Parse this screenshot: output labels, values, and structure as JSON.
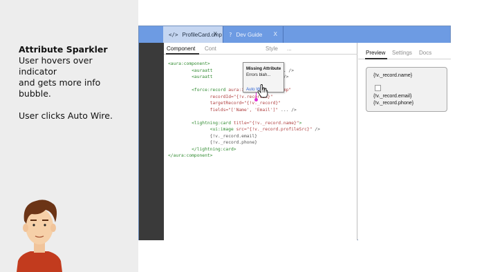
{
  "caption": {
    "title": "Attribute Sparkler",
    "body": "User hovers over indicator\nand gets more info\nbubble.",
    "action": "User clicks Auto Wire."
  },
  "tabs": [
    {
      "icon": "</>",
      "label": "ProfileCard.cmp",
      "close": "X"
    },
    {
      "icon": "?",
      "label": "Dev Guide",
      "close": "X"
    }
  ],
  "editor": {
    "tabs": [
      "Component",
      "Cont",
      "Style",
      "..."
    ]
  },
  "code": [
    [
      {
        "c": "tag",
        "t": "<aura:component>"
      }
    ],
    [
      {
        "c": "tag",
        "t": "         <auraatt"
      },
      {
        "c": "attr",
        "t": "               recordId\""
      },
      {
        "c": "plain",
        "t": " ... />"
      }
    ],
    [
      {
        "c": "tag",
        "t": "         <auraatt"
      },
      {
        "c": "attr",
        "t": "               record\""
      },
      {
        "c": "plain",
        "t": " ... />"
      }
    ],
    [
      {
        "c": "plain",
        "t": ""
      }
    ],
    [
      {
        "c": "tag",
        "t": "         <force:record"
      },
      {
        "c": "attr",
        "t": " aura:id=\"forceRecordCmp\""
      }
    ],
    [
      {
        "c": "attr",
        "t": "                recordId=\"{!v.recordId}\""
      }
    ],
    [
      {
        "c": "attr",
        "t": "                targetRecord=\"{!v._record}\""
      }
    ],
    [
      {
        "c": "attr",
        "t": "                fields=\"['Name', 'Email']\""
      },
      {
        "c": "plain",
        "t": " ... />"
      }
    ],
    [
      {
        "c": "plain",
        "t": ""
      }
    ],
    [
      {
        "c": "tag",
        "t": "         <lightning:card"
      },
      {
        "c": "attr",
        "t": " title=\"{!v._record.name}\""
      },
      {
        "c": "tag",
        "t": ">"
      }
    ],
    [
      {
        "c": "tag",
        "t": "                <ui:image"
      },
      {
        "c": "attr",
        "t": " src=\"{!v._record.profileSrc}\""
      },
      {
        "c": "plain",
        "t": " />"
      }
    ],
    [
      {
        "c": "plain",
        "t": "                {!v._record.email}"
      }
    ],
    [
      {
        "c": "plain",
        "t": "                {!v._record.phone}"
      }
    ],
    [
      {
        "c": "tag",
        "t": "         </lightning:card>"
      }
    ],
    [
      {
        "c": "tag",
        "t": "</aura:component>"
      }
    ]
  ],
  "popup": {
    "title": "Missing Attribute",
    "message": "Errors blah...",
    "action": "Auto Wire"
  },
  "right_pane": {
    "tabs": [
      "Preview",
      "Settings",
      "Docs"
    ],
    "preview": {
      "name": "{!v._record.name}",
      "email": "{!v._record.email}",
      "phone": "{!v._record.phone}"
    }
  },
  "colors": {
    "tabbar": "#6d9be3",
    "indicator": "#e02bd6",
    "link": "#2a5fd0"
  }
}
